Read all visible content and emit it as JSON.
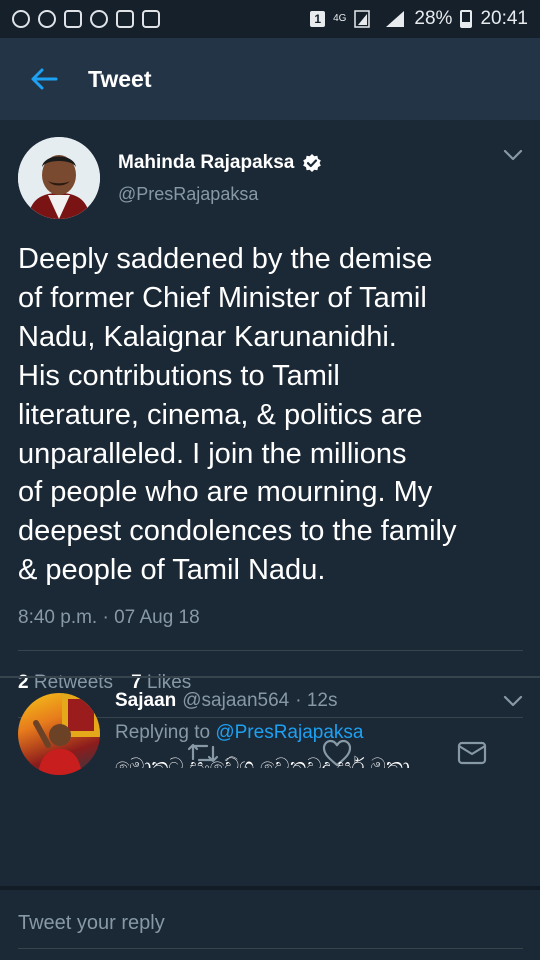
{
  "status_bar": {
    "sim": "1",
    "network": "4G",
    "battery_pct": "28%",
    "battery_level": 0.28,
    "time": "20:41"
  },
  "header": {
    "title": "Tweet",
    "back_icon": "arrow-left-icon",
    "accent": "#1da1f2"
  },
  "tweet": {
    "author_name": "Mahinda Rajapaksa",
    "verified": true,
    "handle": "@PresRajapaksa",
    "text": "Deeply saddened by the demise\nof former Chief Minister of Tamil\nNadu, Kalaignar Karunanidhi.\nHis contributions to Tamil\nliterature, cinema, & politics are\nunparalleled. I join the millions\nof people who are mourning. My\ndeepest condolences to the family\n& people of Tamil Nadu.",
    "timestamp": "8:40 p.m. · 07 Aug 18",
    "retweets_count": "2",
    "retweets_label": "Retweets",
    "likes_count": "7",
    "likes_label": "Likes",
    "actions": [
      "reply-icon",
      "retweet-icon",
      "like-icon",
      "dm-icon"
    ]
  },
  "reply": {
    "name": "Sajaan",
    "handle": "@sajaan564",
    "time": "· 12s",
    "replying_prefix": "Replying to",
    "replying_to": "@PresRajapaksa",
    "text": "මොකට සංවේග වෙනවද සර් ඔකා"
  },
  "composer": {
    "placeholder": "Tweet your reply"
  },
  "colors": {
    "background": "#1b2836",
    "appbar": "#243447",
    "secondary_text": "#8899a6",
    "divider": "#38444d"
  }
}
